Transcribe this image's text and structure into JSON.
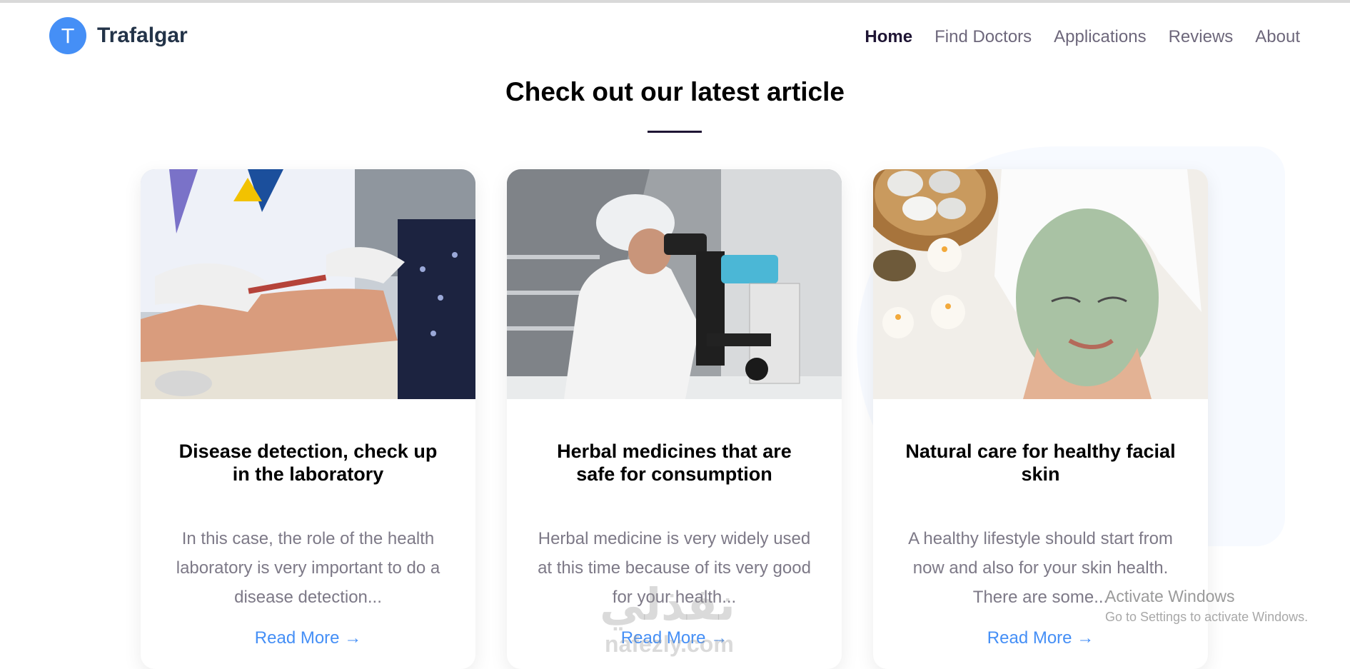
{
  "header": {
    "logo_letter": "T",
    "brand": "Trafalgar",
    "nav": [
      {
        "label": "Home",
        "active": true
      },
      {
        "label": "Find Doctors",
        "active": false
      },
      {
        "label": "Applications",
        "active": false
      },
      {
        "label": "Reviews",
        "active": false
      },
      {
        "label": "About",
        "active": false
      }
    ]
  },
  "section": {
    "title": "Check out our latest article"
  },
  "articles": [
    {
      "title": "Disease detection, check up in the laboratory",
      "excerpt": "In this case, the role of the health laboratory is very important to do a disease detection...",
      "link": "Read More →",
      "image": "laboratory-blood-test-photo"
    },
    {
      "title": "Herbal medicines that are safe for consumption",
      "excerpt": "Herbal medicine is very widely used at this time because of its very good for your health...",
      "link": "Read More →",
      "image": "scientist-microscope-photo"
    },
    {
      "title": "Natural care for healthy facial skin",
      "excerpt": "A healthy lifestyle should start from now and also for your skin health. There are some...",
      "link": "Read More →",
      "image": "facial-mask-spa-photo"
    }
  ],
  "watermarks": {
    "windows_title": "Activate Windows",
    "windows_sub": "Go to Settings to activate Windows.",
    "site_arabic": "نفذلي",
    "site_latin": "nafezly.com"
  },
  "colors": {
    "accent": "#458ff6",
    "heading": "#1f1534",
    "body_text": "#7d7987"
  }
}
